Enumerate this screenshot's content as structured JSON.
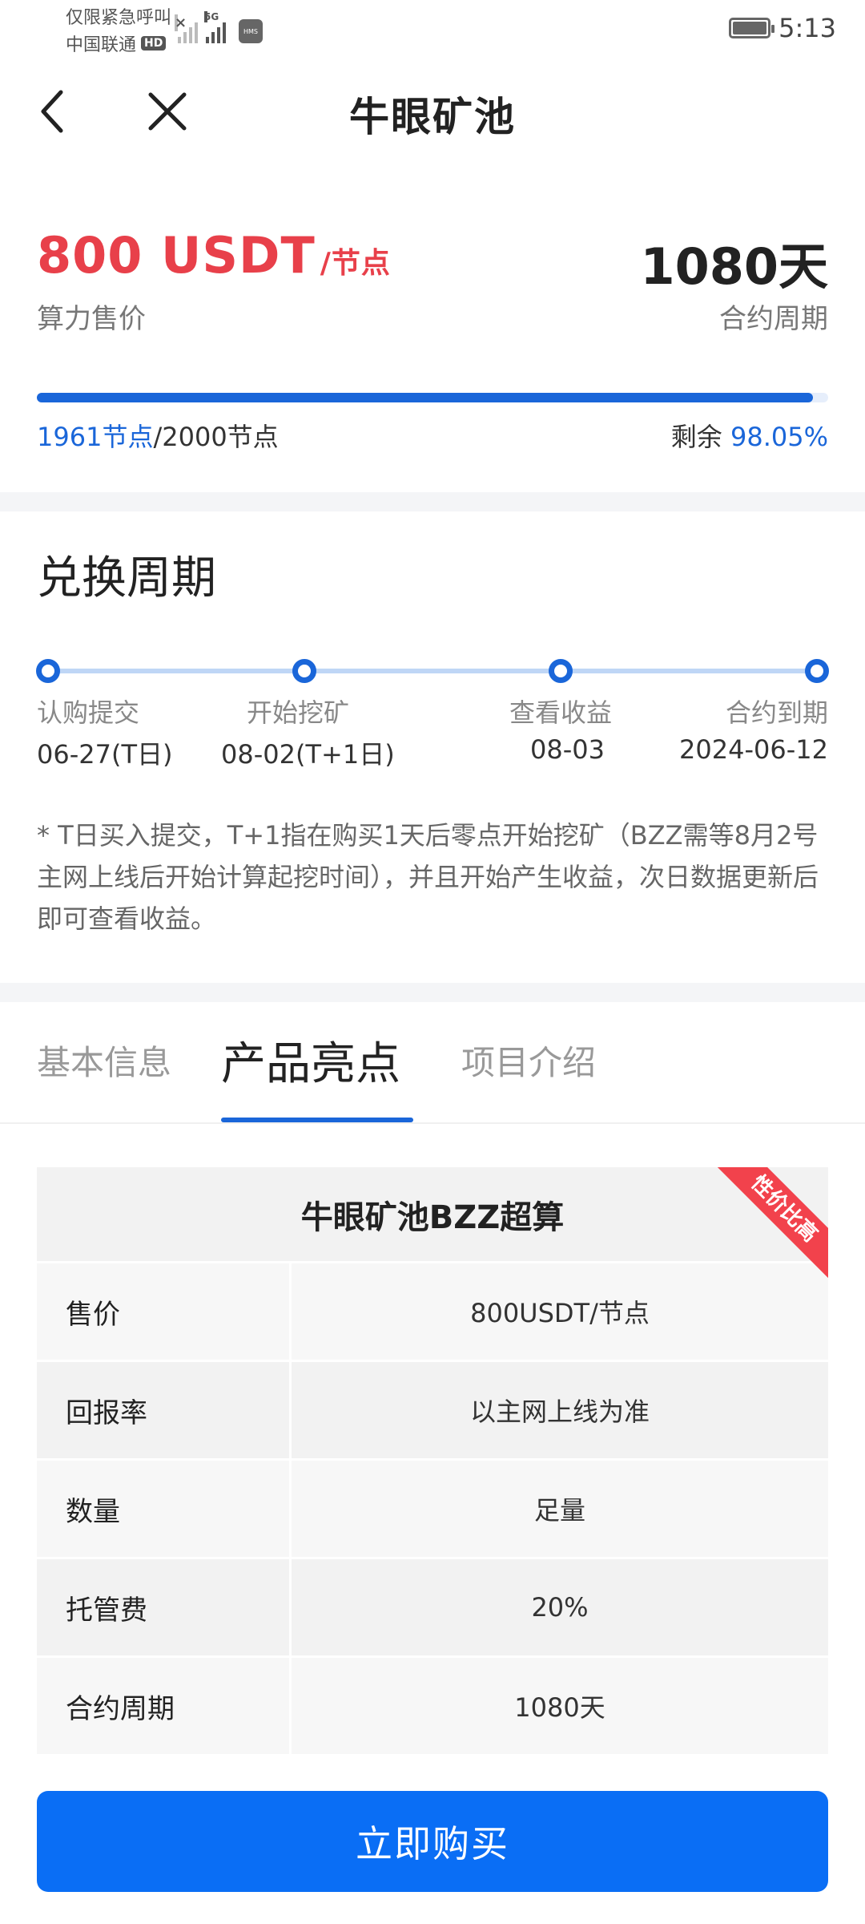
{
  "status_bar": {
    "carrier_line1": "仅限紧急呼叫",
    "carrier_line2": "中国联通",
    "hd_badge": "HD",
    "network": "5G",
    "hms_label": "HMS",
    "time": "5:13"
  },
  "nav": {
    "title": "牛眼矿池",
    "back_icon": "chevron-left-icon",
    "close_icon": "close-icon"
  },
  "price": {
    "amount": "800 USDT",
    "unit": "/节点",
    "label": "算力售价",
    "period_value": "1080天",
    "period_label": "合约周期",
    "progress_fraction": 0.9805,
    "sold": "1961节点",
    "total": "/2000节点",
    "remaining_label": "剩余 ",
    "remaining_value": "98.05%"
  },
  "cycle": {
    "title": "兑换周期",
    "steps": [
      {
        "label": "认购提交",
        "date": "06-27(T日)"
      },
      {
        "label": "开始挖矿",
        "date": "08-02(T+1日)"
      },
      {
        "label": "查看收益",
        "date": "08-03"
      },
      {
        "label": "合约到期",
        "date": "2024-06-12"
      }
    ],
    "note": "* T日买入提交，T+1指在购买1天后零点开始挖矿（BZZ需等8月2号主网上线后开始计算起挖时间），并且开始产生收益，次日数据更新后即可查看收益。"
  },
  "tabs": [
    {
      "label": "基本信息",
      "active": false
    },
    {
      "label": "产品亮点",
      "active": true
    },
    {
      "label": "项目介绍",
      "active": false
    }
  ],
  "product": {
    "title": "牛眼矿池BZZ超算",
    "ribbon": "性价比高",
    "rows": [
      {
        "key": "售价",
        "value": "800USDT/节点"
      },
      {
        "key": "回报率",
        "value": "以主网上线为准"
      },
      {
        "key": "数量",
        "value": "足量"
      },
      {
        "key": "托管费",
        "value": "20%"
      },
      {
        "key": "合约周期",
        "value": "1080天"
      }
    ]
  },
  "buy_button": "立即购买",
  "colors": {
    "accent_blue": "#1a66d9",
    "price_red": "#e8404a",
    "button_blue": "#0a6ef5"
  }
}
